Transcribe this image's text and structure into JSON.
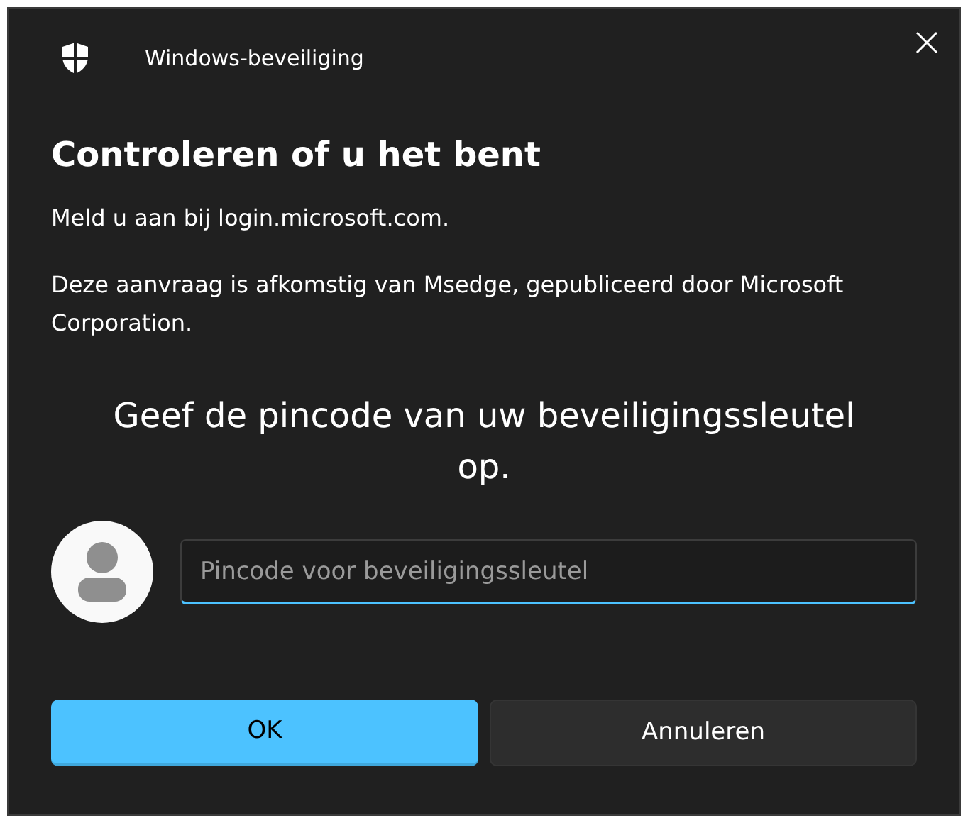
{
  "window": {
    "title": "Windows-beveiliging"
  },
  "heading": "Controleren of u het bent",
  "paragraphs": [
    "Meld u aan bij login.microsoft.com.",
    "Deze aanvraag is afkomstig van Msedge, gepubliceerd door Microsoft Corporation."
  ],
  "prompt": "Geef de pincode van uw beveiligingssleutel op.",
  "pin_field": {
    "placeholder": "Pincode voor beveiligingssleutel"
  },
  "buttons": [
    {
      "label": "OK",
      "kind": "primary"
    },
    {
      "label": "Annuleren",
      "kind": "secondary"
    }
  ]
}
